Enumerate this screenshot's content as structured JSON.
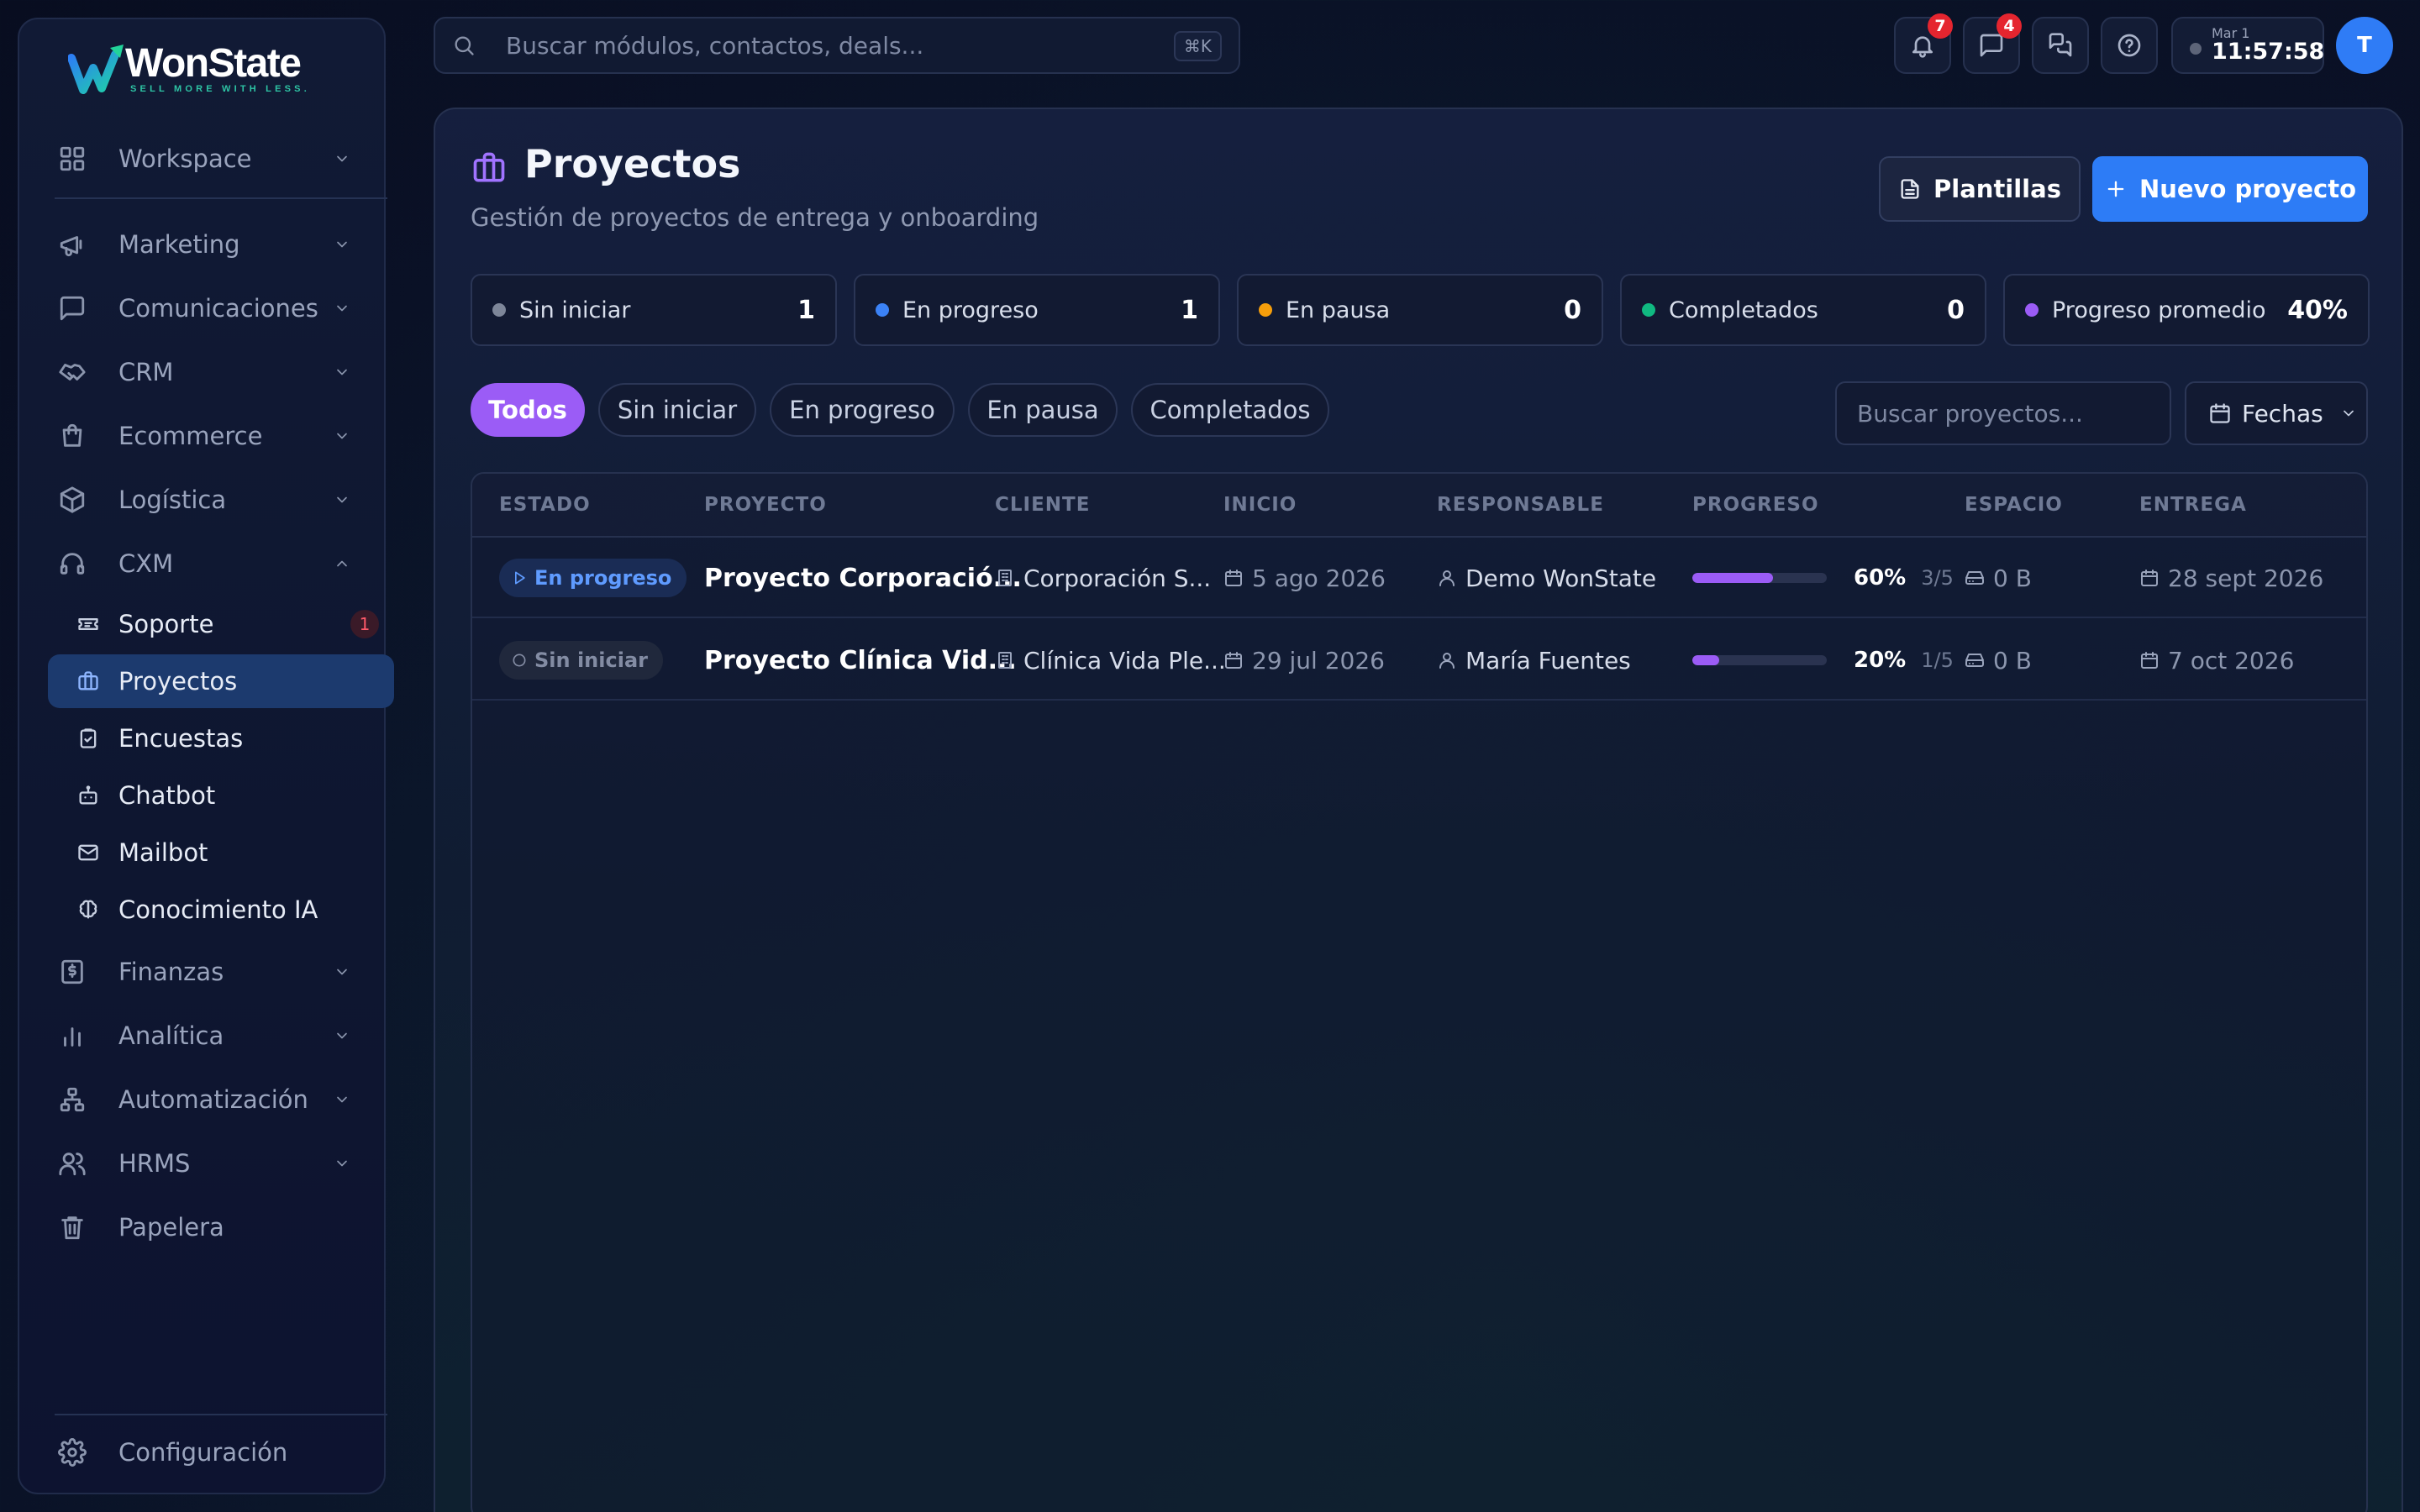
{
  "brand": {
    "name": "WonState",
    "tagline": "SELL MORE WITH LESS."
  },
  "sidebar": {
    "workspace": "Workspace",
    "groups": [
      {
        "label": "Marketing"
      },
      {
        "label": "Comunicaciones"
      },
      {
        "label": "CRM"
      },
      {
        "label": "Ecommerce"
      },
      {
        "label": "Logística"
      },
      {
        "label": "CXM"
      }
    ],
    "cxm_items": [
      {
        "label": "Soporte",
        "badge": "1"
      },
      {
        "label": "Proyectos",
        "active": true
      },
      {
        "label": "Encuestas"
      },
      {
        "label": "Chatbot"
      },
      {
        "label": "Mailbot"
      },
      {
        "label": "Conocimiento IA"
      }
    ],
    "lower_groups": [
      {
        "label": "Finanzas"
      },
      {
        "label": "Analítica"
      },
      {
        "label": "Automatización"
      },
      {
        "label": "HRMS"
      },
      {
        "label": "Papelera"
      }
    ],
    "settings": "Configuración"
  },
  "topbar": {
    "search_placeholder": "Buscar módulos, contactos, deals...",
    "shortcut": "⌘K",
    "notifications_badge": "7",
    "messages_badge": "4",
    "clock_date": "Mar 1",
    "clock_time": "11:57:58",
    "avatar_initial": "T"
  },
  "page": {
    "title": "Proyectos",
    "subtitle": "Gestión de proyectos de entrega y onboarding",
    "templates_button": "Plantillas",
    "new_button": "Nuevo proyecto"
  },
  "stats": [
    {
      "label": "Sin iniciar",
      "value": "1",
      "color": "#7d8699"
    },
    {
      "label": "En progreso",
      "value": "1",
      "color": "#3b82f6"
    },
    {
      "label": "En pausa",
      "value": "0",
      "color": "#f59e0b"
    },
    {
      "label": "Completados",
      "value": "0",
      "color": "#10b981"
    },
    {
      "label": "Progreso promedio",
      "value": "40%",
      "color": "#9b5cf6"
    }
  ],
  "filters": [
    "Todos",
    "Sin iniciar",
    "En progreso",
    "En pausa",
    "Completados"
  ],
  "project_search_placeholder": "Buscar proyectos...",
  "dates_button": "Fechas",
  "table": {
    "headers": [
      "ESTADO",
      "PROYECTO",
      "CLIENTE",
      "INICIO",
      "RESPONSABLE",
      "PROGRESO",
      "ESPACIO",
      "ENTREGA"
    ],
    "rows": [
      {
        "status": "En progreso",
        "project": "Proyecto Corporació...",
        "client": "Corporación S...",
        "start": "5 ago 2026",
        "owner": "Demo WonState",
        "progress": 0.6,
        "progress_label": "60%",
        "tasks": "3/5",
        "space": "0 B",
        "due": "28 sept 2026"
      },
      {
        "status": "Sin iniciar",
        "project": "Proyecto Clínica Vid...",
        "client": "Clínica Vida Ple...",
        "start": "29 jul 2026",
        "owner": "María Fuentes",
        "progress": 0.2,
        "progress_label": "20%",
        "tasks": "1/5",
        "space": "0 B",
        "due": "7 oct 2026"
      }
    ]
  }
}
